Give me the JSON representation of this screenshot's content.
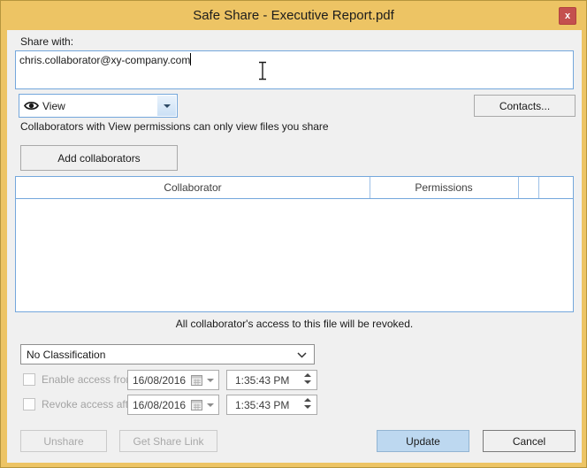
{
  "window": {
    "title": "Safe Share - Executive Report.pdf",
    "close_glyph": "x"
  },
  "colors": {
    "titlebar": "#EDC464",
    "close_button": "#C4504E",
    "focus_border": "#74A7DC",
    "update_button_fill": "#BDD8F0"
  },
  "share": {
    "label": "Share with:",
    "input_value": "chris.collaborator@xy-company.com",
    "permission": {
      "value": "View"
    },
    "contacts_button": "Contacts...",
    "helper_text": "Collaborators with View permissions can only view files you share",
    "add_button": "Add collaborators"
  },
  "collaborator_table": {
    "columns": [
      "Collaborator",
      "Permissions"
    ],
    "rows": [],
    "footer_note": "All collaborator's access to this file will be revoked."
  },
  "classification": {
    "value": "No Classification"
  },
  "access_schedule": {
    "enable_row": {
      "label": "Enable access from",
      "checked": false,
      "date": "16/08/2016",
      "time": "1:35:43 PM"
    },
    "revoke_row": {
      "label": "Revoke access after",
      "checked": false,
      "date": "16/08/2016",
      "time": "1:35:43 PM"
    }
  },
  "footer": {
    "unshare": "Unshare",
    "get_share_link": "Get Share Link",
    "update": "Update",
    "cancel": "Cancel"
  }
}
